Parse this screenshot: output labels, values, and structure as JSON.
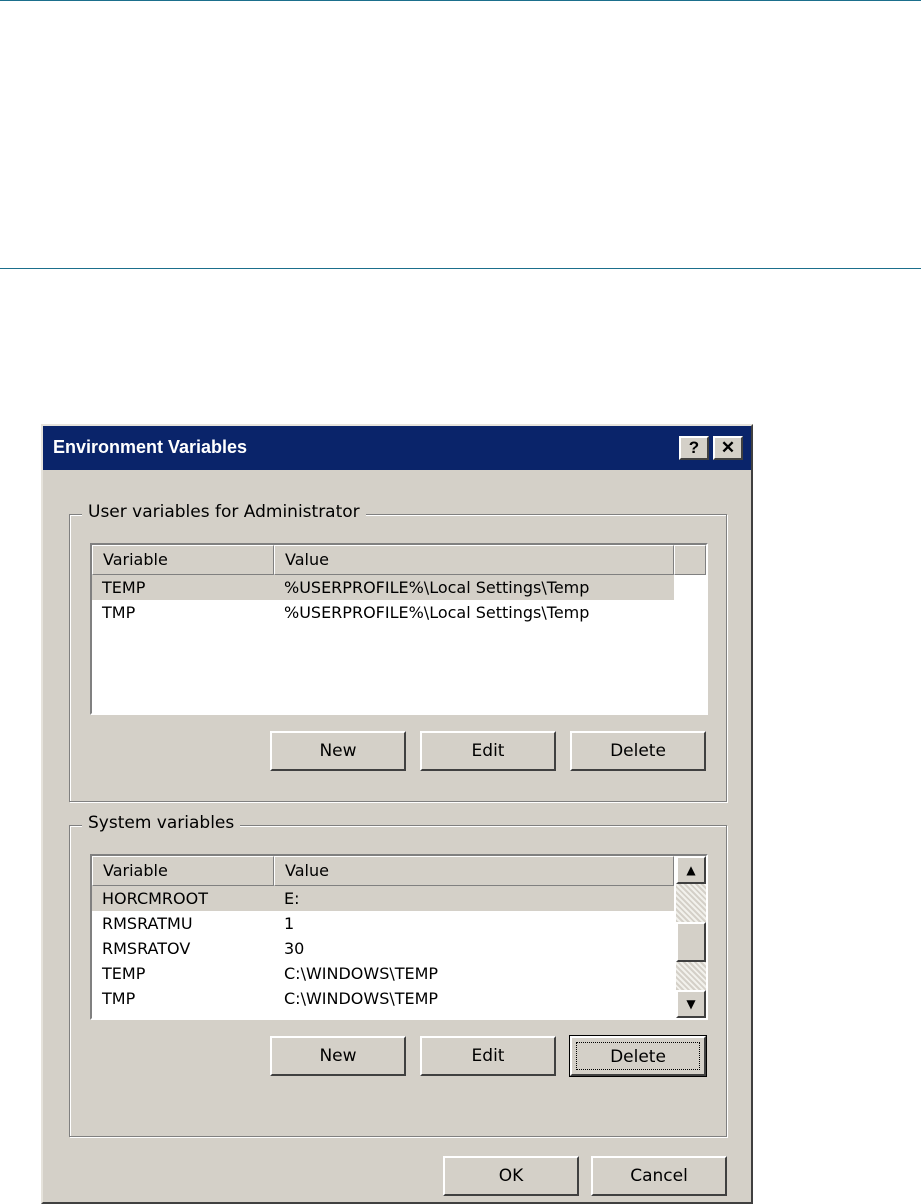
{
  "dialog": {
    "title": "Environment Variables",
    "help_glyph": "?",
    "close_glyph": "✕"
  },
  "user_vars": {
    "label": "User variables for Administrator",
    "columns": {
      "variable": "Variable",
      "value": "Value"
    },
    "rows": [
      {
        "variable": "TEMP",
        "value": "%USERPROFILE%\\Local Settings\\Temp",
        "selected": true
      },
      {
        "variable": "TMP",
        "value": "%USERPROFILE%\\Local Settings\\Temp",
        "selected": false
      }
    ],
    "buttons": {
      "new": "New",
      "edit": "Edit",
      "delete": "Delete"
    }
  },
  "system_vars": {
    "label": "System variables",
    "columns": {
      "variable": "Variable",
      "value": "Value"
    },
    "rows": [
      {
        "variable": "HORCMROOT",
        "value": "E:",
        "selected": true
      },
      {
        "variable": "RMSRATMU",
        "value": "1",
        "selected": false
      },
      {
        "variable": "RMSRATOV",
        "value": "30",
        "selected": false
      },
      {
        "variable": "TEMP",
        "value": "C:\\WINDOWS\\TEMP",
        "selected": false
      },
      {
        "variable": "TMP",
        "value": "C:\\WINDOWS\\TEMP",
        "selected": false
      }
    ],
    "buttons": {
      "new": "New",
      "edit": "Edit",
      "delete": "Delete"
    },
    "scrollbar": {
      "up_glyph": "▲",
      "down_glyph": "▼"
    }
  },
  "footer": {
    "ok": "OK",
    "cancel": "Cancel"
  },
  "colors": {
    "title_bar": "#0a246a",
    "face": "#d4d0c8",
    "rule": "#1b6f8c"
  }
}
